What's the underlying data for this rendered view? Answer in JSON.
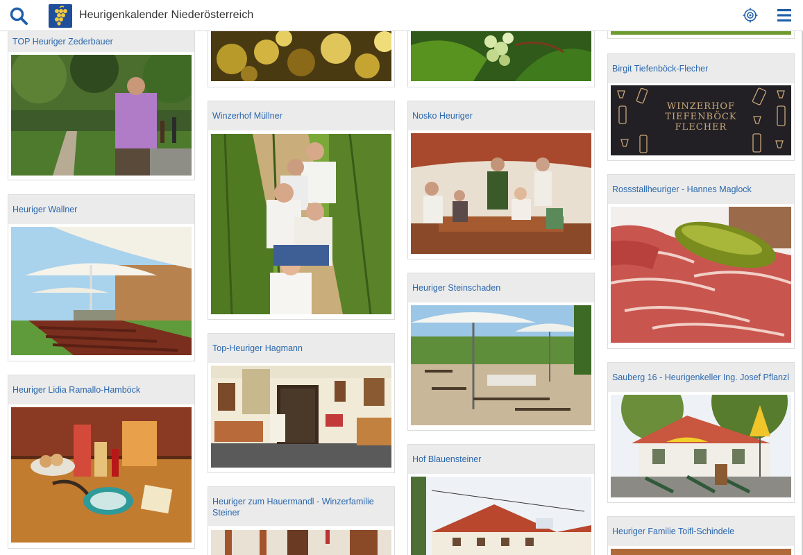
{
  "header": {
    "title": "Heurigenkalender Niederösterreich",
    "brand_color": "#1f4e9a",
    "icons": [
      "search-icon",
      "grape-logo",
      "locate-icon",
      "menu-icon"
    ]
  },
  "listings": [
    {
      "name": "TOP Heuriger Zederbauer"
    },
    {
      "name": "Heuriger Wallner"
    },
    {
      "name": "Heuriger Lidia Ramallo-Hamböck"
    },
    {
      "name": "Winzerhof Müllner"
    },
    {
      "name": "Top-Heuriger Hagmann"
    },
    {
      "name": "Heuriger zum Hauermandl - Winzerfamilie Steiner"
    },
    {
      "name": "Nosko Heuriger"
    },
    {
      "name": "Heuriger Steinschaden"
    },
    {
      "name": "Hof Blauensteiner"
    },
    {
      "name": "Birgit Tiefenböck-Flecher"
    },
    {
      "name": "Rossstallheuriger - Hannes Maglock"
    },
    {
      "name": "Sauberg 16 - Heurigenkeller Ing. Josef Pflanzl"
    },
    {
      "name": "Heuriger Familie Toifl-Schindele"
    }
  ],
  "logo_text": {
    "line1": "WINZERHOF",
    "line2": "TIEFENBÖCK",
    "line3": "FLECHER"
  },
  "colors": {
    "link": "#2a67ad",
    "title_bg": "#ebebeb"
  }
}
